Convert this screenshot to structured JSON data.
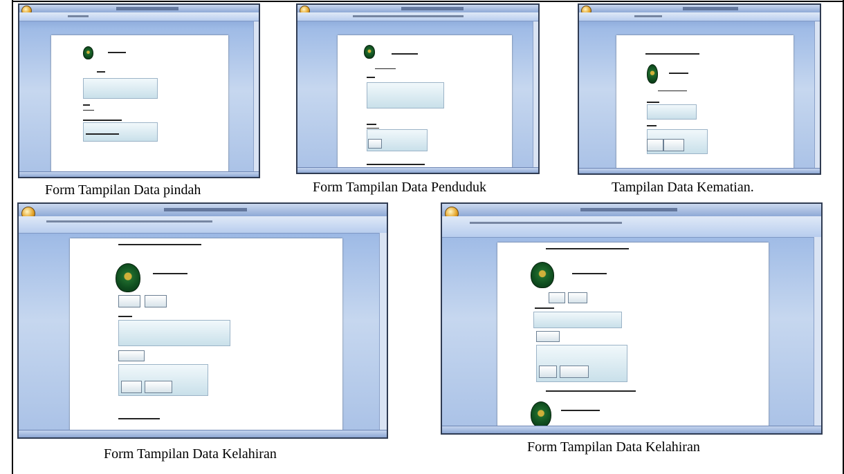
{
  "captions": {
    "top_left": "Form Tampilan Data pindah",
    "top_middle": "Form Tampilan Data Penduduk",
    "top_right": "Tampilan Data Kematian.",
    "bottom_left": "Form Tampilan Data Kelahiran",
    "bottom_right": "Form Tampilan Data Kelahiran"
  },
  "colors": {
    "window_frame": "#2f3b52",
    "window_background": "#9fbbe6",
    "field_fill": "#c9e0ea",
    "logo_green": "#1f6a2c"
  },
  "icons": [
    "office-orb-icon",
    "emblem-logo-icon"
  ]
}
